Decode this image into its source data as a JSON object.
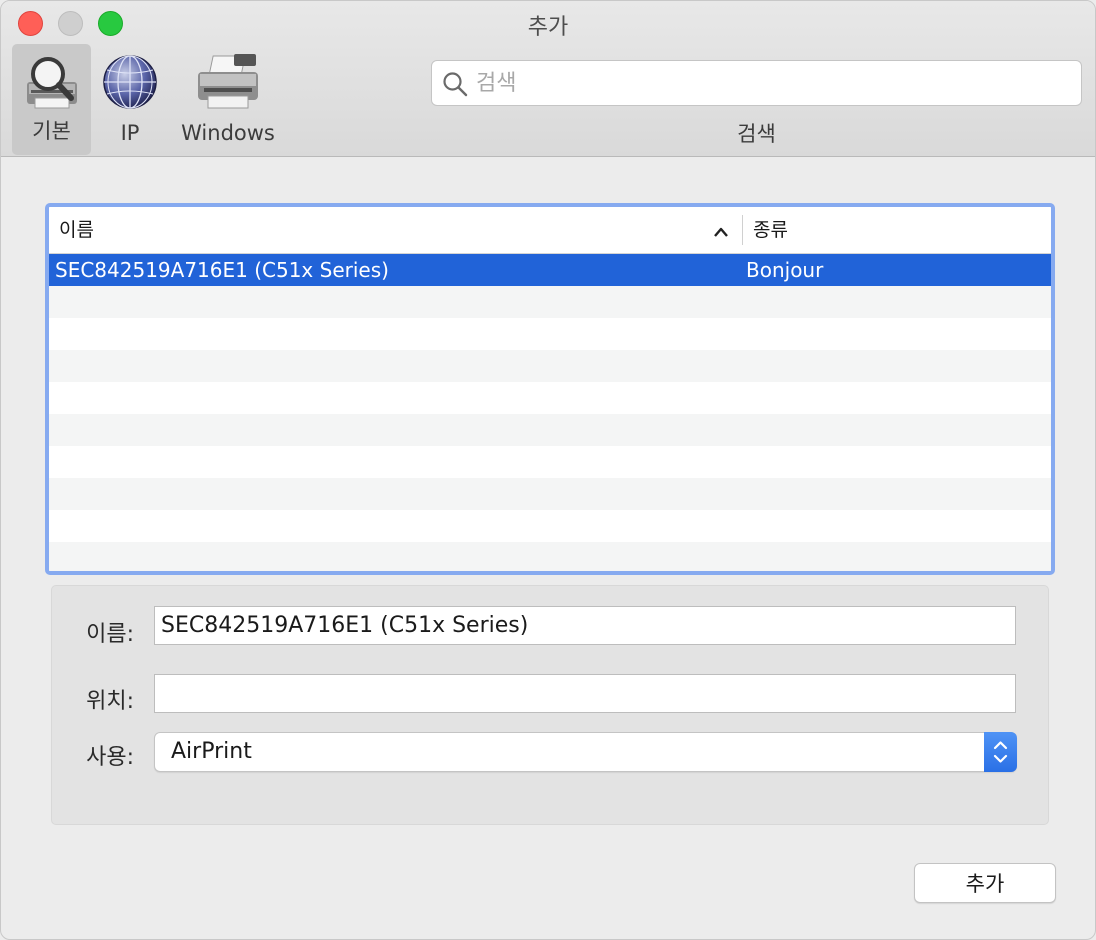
{
  "window": {
    "title": "추가"
  },
  "toolbar": {
    "items": [
      {
        "label": "기본",
        "icon": "printer-search-icon",
        "selected": true
      },
      {
        "label": "IP",
        "icon": "network-globe-icon",
        "selected": false
      },
      {
        "label": "Windows",
        "icon": "printer-icon",
        "selected": false
      }
    ],
    "search": {
      "placeholder": "검색",
      "value": "",
      "label": "검색"
    }
  },
  "table": {
    "columns": [
      "이름",
      "종류"
    ],
    "sort_indicator": "ascending",
    "rows": [
      {
        "name": "SEC842519A716E1 (C51x Series)",
        "kind": "Bonjour",
        "selected": true
      }
    ]
  },
  "details": {
    "name_label": "이름:",
    "name_value": "SEC842519A716E1 (C51x Series)",
    "location_label": "위치:",
    "location_value": "",
    "use_label": "사용:",
    "use_value": "AirPrint"
  },
  "actions": {
    "add_label": "추가"
  },
  "colors": {
    "selection": "#2163d8",
    "focus_ring": "#86aaf0",
    "stepper": "#2a70e6"
  }
}
